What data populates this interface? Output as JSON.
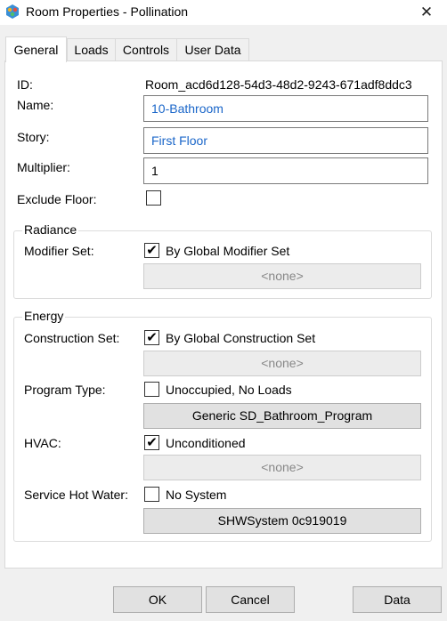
{
  "window": {
    "title": "Room Properties - Pollination",
    "close_glyph": "✕",
    "icon": "pollination-logo-icon"
  },
  "tabs": [
    {
      "label": "General",
      "active": true
    },
    {
      "label": "Loads",
      "active": false
    },
    {
      "label": "Controls",
      "active": false
    },
    {
      "label": "User Data",
      "active": false
    }
  ],
  "general": {
    "id_label": "ID:",
    "id_value": "Room_acd6d128-54d3-48d2-9243-671adf8ddc3",
    "name_label": "Name:",
    "name_value": "10-Bathroom",
    "story_label": "Story:",
    "story_value": "First Floor",
    "multiplier_label": "Multiplier:",
    "multiplier_value": "1",
    "exclude_floor_label": "Exclude Floor:",
    "exclude_floor_checked": false
  },
  "radiance": {
    "title": "Radiance",
    "modifier_set_label": "Modifier Set:",
    "modifier_set_checkbox_label": "By Global Modifier Set",
    "modifier_set_checked": true,
    "modifier_set_button": "<none>"
  },
  "energy": {
    "title": "Energy",
    "construction_set_label": "Construction Set:",
    "construction_set_checkbox_label": "By Global Construction Set",
    "construction_set_checked": true,
    "construction_set_button": "<none>",
    "program_type_label": "Program Type:",
    "program_type_checkbox_label": "Unoccupied, No Loads",
    "program_type_checked": false,
    "program_type_button": "Generic SD_Bathroom_Program",
    "hvac_label": "HVAC:",
    "hvac_checkbox_label": "Unconditioned",
    "hvac_checked": true,
    "hvac_button": "<none>",
    "shw_label": "Service Hot Water:",
    "shw_checkbox_label": "No System",
    "shw_checked": false,
    "shw_button": "SHWSystem 0c919019"
  },
  "footer": {
    "ok_label": "OK",
    "cancel_label": "Cancel",
    "data_label": "Data"
  },
  "check_glyph": "✔"
}
